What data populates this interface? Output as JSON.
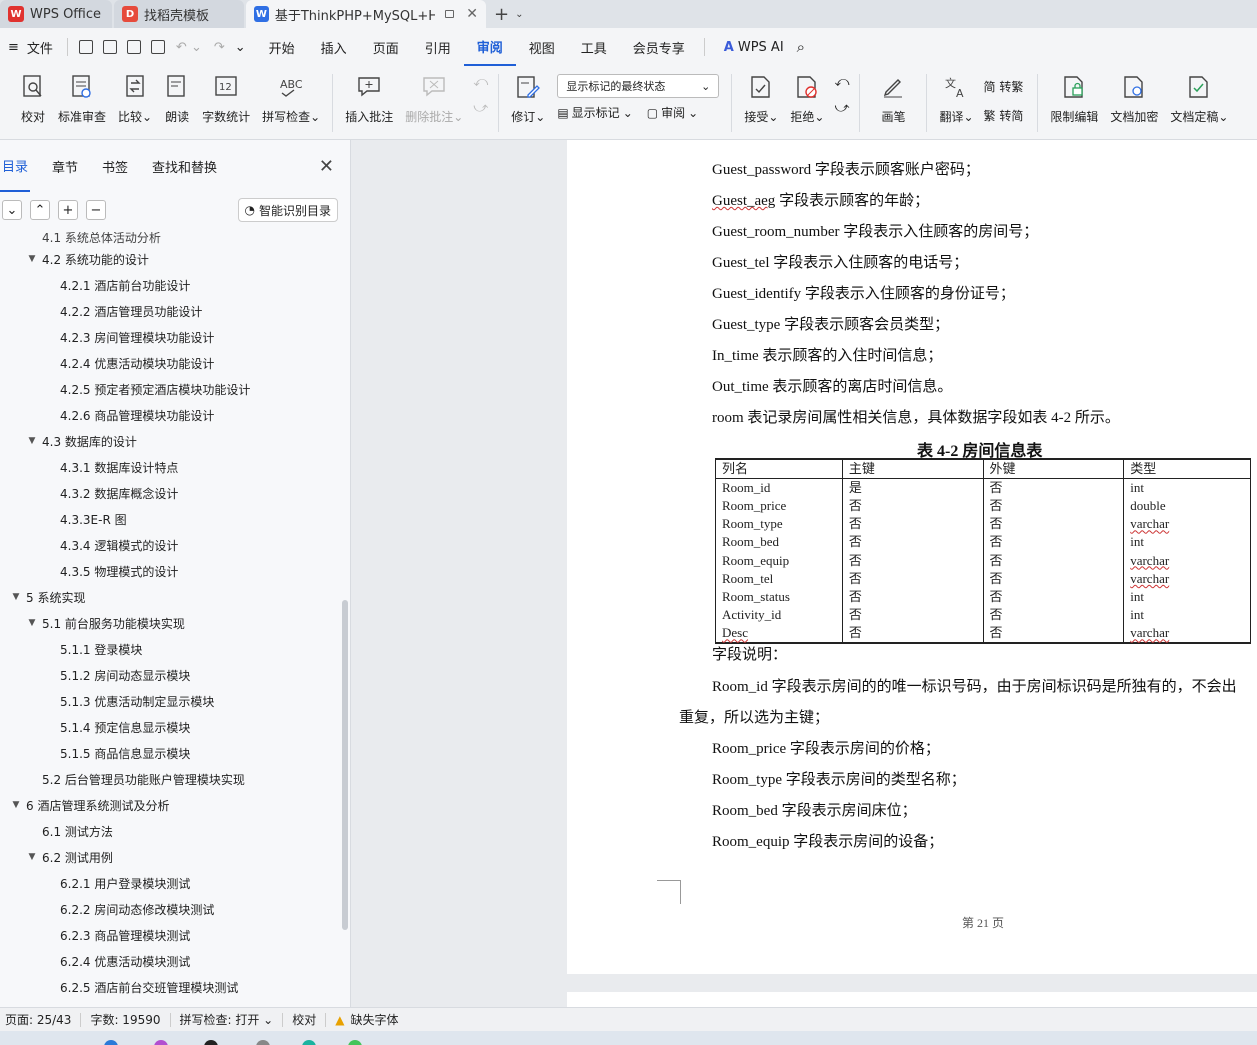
{
  "tabs": [
    {
      "label": "WPS Office"
    },
    {
      "label": "找稻壳模板"
    },
    {
      "label": "基于ThinkPHP+MySQL+HTM"
    }
  ],
  "menu": {
    "file": "文件",
    "items": [
      "开始",
      "插入",
      "页面",
      "引用",
      "审阅",
      "视图",
      "工具",
      "会员专享"
    ],
    "active": "审阅",
    "wps_ai": "WPS AI"
  },
  "ribbon": {
    "proofread": "校对",
    "standard_review": "标准审查",
    "compare": "比较",
    "read_aloud": "朗读",
    "word_count": "字数统计",
    "spell_check": "拼写检查",
    "insert_comment": "插入批注",
    "delete_comment": "删除批注",
    "track": "修订",
    "markup_dropdown": "显示标记的最终状态",
    "show_markup": "显示标记",
    "review": "审阅",
    "accept": "接受",
    "reject": "拒绝",
    "pen": "画笔",
    "translate": "翻译",
    "to_traditional": "简 转繁",
    "to_simplified": "繁 转简",
    "restrict_edit": "限制编辑",
    "encrypt": "文档加密",
    "finalize": "文档定稿"
  },
  "nav": {
    "tabs": [
      "目录",
      "章节",
      "书签",
      "查找和替换"
    ],
    "active_tab": "目录",
    "smart_toc": "智能识别目录",
    "items": [
      {
        "level": 2,
        "label": "4.1 系统总体活动分析",
        "arrow": ""
      },
      {
        "level": 2,
        "label": "4.2 系统功能的设计",
        "arrow": "▼"
      },
      {
        "level": 3,
        "label": "4.2.1 酒店前台功能设计",
        "arrow": ""
      },
      {
        "level": 3,
        "label": "4.2.2 酒店管理员功能设计",
        "arrow": ""
      },
      {
        "level": 3,
        "label": "4.2.3 房间管理模块功能设计",
        "arrow": ""
      },
      {
        "level": 3,
        "label": "4.2.4 优惠活动模块功能设计",
        "arrow": ""
      },
      {
        "level": 3,
        "label": "4.2.5 预定者预定酒店模块功能设计",
        "arrow": ""
      },
      {
        "level": 3,
        "label": "4.2.6 商品管理模块功能设计",
        "arrow": ""
      },
      {
        "level": 2,
        "label": "4.3 数据库的设计",
        "arrow": "▼"
      },
      {
        "level": 3,
        "label": "4.3.1 数据库设计特点",
        "arrow": ""
      },
      {
        "level": 3,
        "label": "4.3.2 数据库概念设计",
        "arrow": ""
      },
      {
        "level": 3,
        "label": "4.3.3E-R 图",
        "arrow": ""
      },
      {
        "level": 3,
        "label": "4.3.4 逻辑模式的设计",
        "arrow": ""
      },
      {
        "level": 3,
        "label": "4.3.5 物理模式的设计",
        "arrow": ""
      },
      {
        "level": 1,
        "label": "5 系统实现",
        "arrow": "▼"
      },
      {
        "level": 2,
        "label": "5.1 前台服务功能模块实现",
        "arrow": "▼"
      },
      {
        "level": 3,
        "label": "5.1.1 登录模块",
        "arrow": ""
      },
      {
        "level": 3,
        "label": "5.1.2 房间动态显示模块",
        "arrow": ""
      },
      {
        "level": 3,
        "label": "5.1.3 优惠活动制定显示模块",
        "arrow": ""
      },
      {
        "level": 3,
        "label": "5.1.4 预定信息显示模块",
        "arrow": ""
      },
      {
        "level": 3,
        "label": "5.1.5 商品信息显示模块",
        "arrow": ""
      },
      {
        "level": 2,
        "label": "5.2 后台管理员功能账户管理模块实现",
        "arrow": ""
      },
      {
        "level": 1,
        "label": "6 酒店管理系统测试及分析",
        "arrow": "▼"
      },
      {
        "level": 2,
        "label": "6.1 测试方法",
        "arrow": ""
      },
      {
        "level": 2,
        "label": "6.2 测试用例",
        "arrow": "▼"
      },
      {
        "level": 3,
        "label": "6.2.1 用户登录模块测试",
        "arrow": ""
      },
      {
        "level": 3,
        "label": "6.2.2 房间动态修改模块测试",
        "arrow": ""
      },
      {
        "level": 3,
        "label": "6.2.3 商品管理模块测试",
        "arrow": ""
      },
      {
        "level": 3,
        "label": "6.2.4 优惠活动模块测试",
        "arrow": ""
      },
      {
        "level": 3,
        "label": "6.2.5 酒店前台交班管理模块测试",
        "arrow": ""
      }
    ]
  },
  "doc": {
    "lines": [
      {
        "code": "Guest_password",
        "text": " 字段表示顾客账户密码；"
      },
      {
        "code": "Guest_aeg",
        "text": " 字段表示顾客的年龄；"
      },
      {
        "code": "Guest_room_number",
        "text": " 字段表示入住顾客的房间号；"
      },
      {
        "code": "Guest_tel",
        "text": " 字段表示入住顾客的电话号；"
      },
      {
        "code": "Guest_identify",
        "text": " 字段表示入住顾客的身份证号；"
      },
      {
        "code": "Guest_type",
        "text": " 字段表示顾客会员类型；"
      },
      {
        "code": "In_time",
        "text": " 表示顾客的入住时间信息；"
      },
      {
        "code": "Out_time",
        "text": " 表示顾客的离店时间信息。"
      },
      {
        "code": "room",
        "text": " 表记录房间属性相关信息，具体数据字段如表 4-2 所示。"
      }
    ],
    "table_caption": "表 4-2  房间信息表",
    "table_header": [
      "列名",
      "主键",
      "外键",
      "类型"
    ],
    "table_rows": [
      [
        "Room_id",
        "是",
        "否",
        "int"
      ],
      [
        "Room_price",
        "否",
        "否",
        "double"
      ],
      [
        "Room_type",
        "否",
        "否",
        "varchar"
      ],
      [
        "Room_bed",
        "否",
        "否",
        "int"
      ],
      [
        "Room_equip",
        "否",
        "否",
        "varchar"
      ],
      [
        "Room_tel",
        "否",
        "否",
        "varchar"
      ],
      [
        "Room_status",
        "否",
        "否",
        "int"
      ],
      [
        "Activity_id",
        "否",
        "否",
        "int"
      ],
      [
        "Desc",
        "否",
        "否",
        "varchar"
      ]
    ],
    "field_desc": "字段说明：",
    "room_id_line1": "Room_id 字段表示房间的的唯一标识号码，由于房间标识码是所独有的，不会出",
    "room_id_line2": "重复，所以选为主键；",
    "after": [
      "Room_price 字段表示房间的价格；",
      "Room_type 字段表示房间的类型名称；",
      "Room_bed 字段表示房间床位；",
      "Room_equip 字段表示房间的设备；"
    ],
    "page_number": "第 21 页"
  },
  "status": {
    "page": "页面: 25/43",
    "words": "字数: 19590",
    "spell": "拼写检查: 打开",
    "proof": "校对",
    "missing_font": "缺失字体"
  }
}
